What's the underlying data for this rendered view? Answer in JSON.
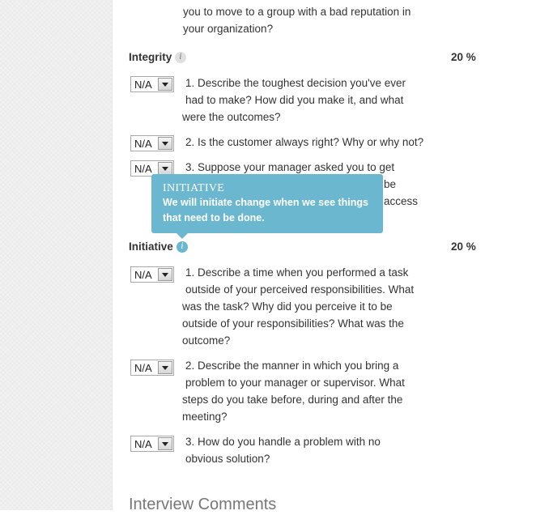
{
  "prev_question_tail": {
    "lines": [
      "you to move to a group with a bad reputation in",
      "your organization?"
    ]
  },
  "sections": [
    {
      "title": "Integrity",
      "weight": "20 %",
      "questions": [
        {
          "select": "N/A",
          "lines": [
            "1. Describe the toughest decision you've ever",
            "had to make? How did you make it, and what",
            "were the outcomes?"
          ]
        },
        {
          "select": "N/A",
          "lines": [
            "2. Is the customer always right? Why or why not?"
          ]
        },
        {
          "select": "N/A",
          "lines": [
            "3. Suppose your manager asked you to get"
          ],
          "hidden_fragments": [
            "be",
            "access"
          ]
        }
      ]
    },
    {
      "title": "Initiative",
      "weight": "20 %",
      "questions": [
        {
          "select": "N/A",
          "lines": [
            "1. Describe a time when you performed a task",
            "outside of your perceived responsibilities. What",
            "was the task? Why did you perceive it to be",
            "outside of your responsibilities? What was the",
            "outcome?"
          ]
        },
        {
          "select": "N/A",
          "lines": [
            "2. Describe the manner in which you bring a",
            "problem to your manager or supervisor. What",
            "steps do you take before, during and after the",
            "meeting?"
          ]
        },
        {
          "select": "N/A",
          "lines": [
            "3. How do you handle a problem with no",
            "obvious solution?"
          ]
        }
      ]
    }
  ],
  "tooltip": {
    "title": "INITIATIVE",
    "lines": [
      "We will initiate change when we see things",
      "that need to be done."
    ]
  },
  "info_icon_glyph": "i",
  "comments_heading": "Interview Comments",
  "colors": {
    "tooltip_bg": "#6ab7cf",
    "gutter_bg": "#f3f3f3"
  }
}
